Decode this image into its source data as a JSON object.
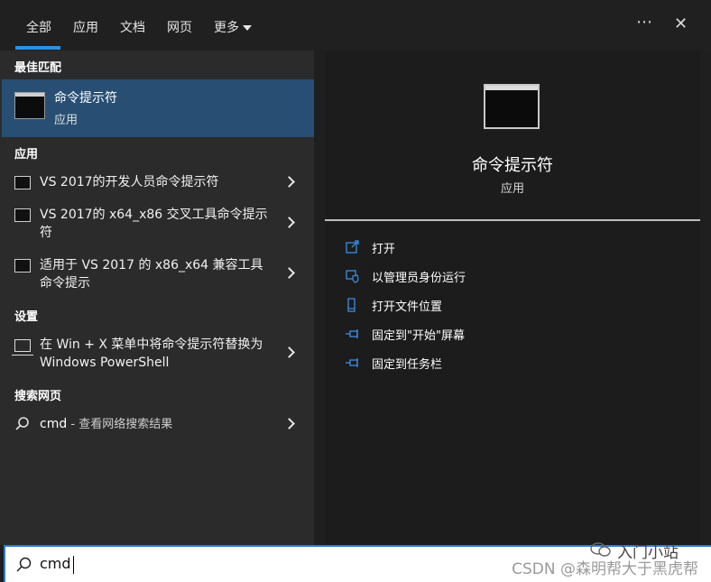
{
  "tabs": [
    {
      "label": "全部",
      "active": true
    },
    {
      "label": "应用"
    },
    {
      "label": "文档"
    },
    {
      "label": "网页"
    },
    {
      "label": "更多"
    }
  ],
  "top_actions": {
    "more_glyph": "⋯",
    "close_glyph": "✕"
  },
  "sections": {
    "best_match": "最佳匹配",
    "apps": "应用",
    "settings": "设置",
    "web": "搜索网页"
  },
  "best_match": {
    "title": "命令提示符",
    "subtitle": "应用",
    "icon": "terminal-icon"
  },
  "apps": [
    {
      "label": "VS 2017的开发人员命令提示符"
    },
    {
      "label": "VS 2017的 x64_x86 交叉工具命令提示符"
    },
    {
      "label": "适用于 VS 2017 的 x86_x64 兼容工具命令提示"
    }
  ],
  "settings": [
    {
      "label": "在 Win + X 菜单中将命令提示符替换为 Windows PowerShell"
    }
  ],
  "web": {
    "query": "cmd",
    "suffix": " - 查看网络搜索结果"
  },
  "preview": {
    "title": "命令提示符",
    "subtitle": "应用"
  },
  "actions": [
    {
      "label": "打开",
      "icon": "open-icon"
    },
    {
      "label": "以管理员身份运行",
      "icon": "shield-icon"
    },
    {
      "label": "打开文件位置",
      "icon": "file-location-icon"
    },
    {
      "label": "固定到\"开始\"屏幕",
      "icon": "pin-icon"
    },
    {
      "label": "固定到任务栏",
      "icon": "pin-icon"
    }
  ],
  "search": {
    "value": "cmd"
  },
  "watermark": {
    "text": "CSDN @森明帮大于黑虎帮",
    "overlay": "入门小站"
  },
  "colors": {
    "accent": "#2e8fe0",
    "best_match_bg": "#284f73",
    "panel_left": "#2b2b2b",
    "panel_right": "#1c1c1c"
  }
}
